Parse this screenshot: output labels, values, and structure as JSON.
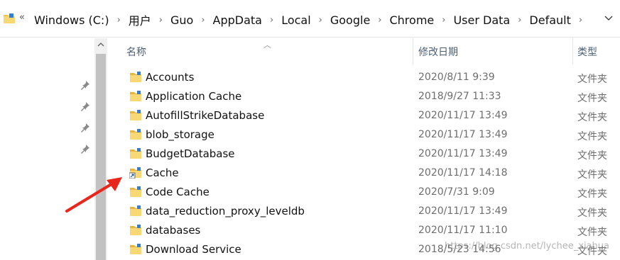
{
  "breadcrumb": {
    "overflow_symbol": "«",
    "items": [
      "Windows (C:)",
      "用户",
      "Guo",
      "AppData",
      "Local",
      "Google",
      "Chrome",
      "User Data",
      "Default"
    ]
  },
  "columns": {
    "name": "名称",
    "date": "修改日期",
    "type": "类型"
  },
  "files": [
    {
      "name": "Accounts",
      "date": "2020/8/11 9:39",
      "type": "文件夹",
      "shortcut": false
    },
    {
      "name": "Application Cache",
      "date": "2018/9/27 11:33",
      "type": "文件夹",
      "shortcut": false
    },
    {
      "name": "AutofillStrikeDatabase",
      "date": "2020/11/17 13:49",
      "type": "文件夹",
      "shortcut": false
    },
    {
      "name": "blob_storage",
      "date": "2020/11/17 13:49",
      "type": "文件夹",
      "shortcut": false
    },
    {
      "name": "BudgetDatabase",
      "date": "2020/11/17 13:49",
      "type": "文件夹",
      "shortcut": false
    },
    {
      "name": "Cache",
      "date": "2020/11/17 14:18",
      "type": "文件夹",
      "shortcut": true
    },
    {
      "name": "Code Cache",
      "date": "2020/7/31 9:09",
      "type": "文件夹",
      "shortcut": false
    },
    {
      "name": "data_reduction_proxy_leveldb",
      "date": "2020/11/17 13:49",
      "type": "文件夹",
      "shortcut": false
    },
    {
      "name": "databases",
      "date": "2020/11/17 11:10",
      "type": "文件夹",
      "shortcut": false
    },
    {
      "name": "Download Service",
      "date": "2018/5/23 14:56",
      "type": "文件夹",
      "shortcut": false
    }
  ],
  "watermark": "https://blog.csdn.net/lychee_xiahua",
  "colors": {
    "folder": "#f5c542",
    "header_text": "#4c607a",
    "annotation_arrow": "#e8261c"
  },
  "icons": {
    "folder": "folder-icon",
    "pin": "pin-icon",
    "shortcut": "shortcut-overlay-icon"
  }
}
